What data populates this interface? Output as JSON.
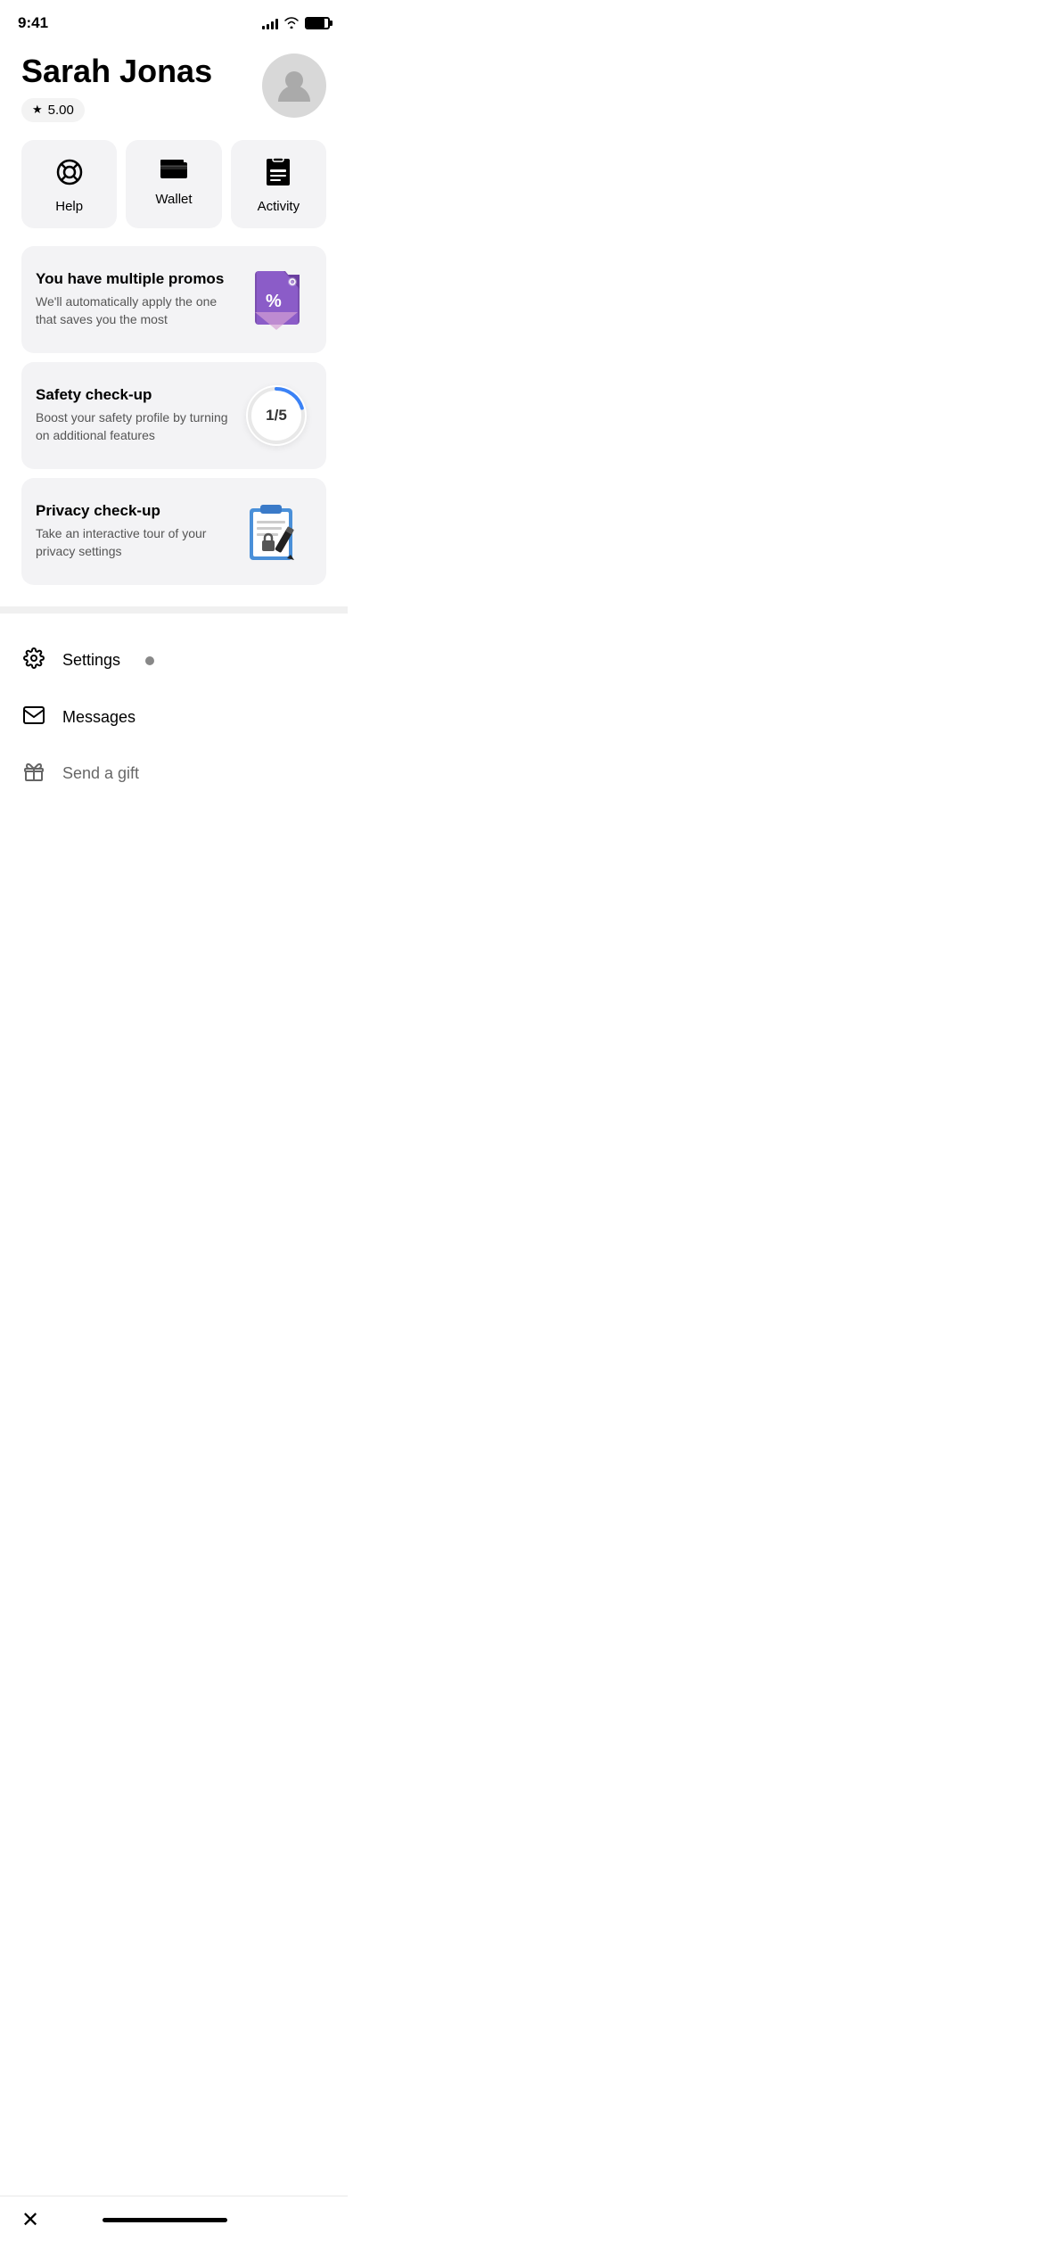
{
  "statusBar": {
    "time": "9:41",
    "signalBars": [
      4,
      6,
      8,
      10,
      12
    ],
    "batteryLevel": 85
  },
  "header": {
    "userName": "Sarah Jonas",
    "rating": "5.00",
    "ratingAriaLabel": "Rating: 5.00 stars",
    "avatarAlt": "User avatar"
  },
  "quickActions": [
    {
      "id": "help",
      "label": "Help",
      "icon": "help-icon"
    },
    {
      "id": "wallet",
      "label": "Wallet",
      "icon": "wallet-icon"
    },
    {
      "id": "activity",
      "label": "Activity",
      "icon": "activity-icon"
    }
  ],
  "promoCards": [
    {
      "id": "promos",
      "title": "You have multiple promos",
      "description": "We'll automatically apply the one that saves you the most",
      "visualType": "promo-tag"
    },
    {
      "id": "safety",
      "title": "Safety check-up",
      "description": "Boost your safety profile by turning on additional features",
      "visualType": "safety-progress",
      "progressText": "1/5"
    },
    {
      "id": "privacy",
      "title": "Privacy check-up",
      "description": "Take an interactive tour of your privacy settings",
      "visualType": "privacy-clipboard"
    }
  ],
  "menuItems": [
    {
      "id": "settings",
      "label": "Settings",
      "icon": "gear-icon",
      "hasBadge": true
    },
    {
      "id": "messages",
      "label": "Messages",
      "icon": "mail-icon",
      "hasBadge": false
    },
    {
      "id": "send-gift",
      "label": "Send a gift",
      "icon": "gift-icon",
      "hasBadge": false,
      "partiallyVisible": true
    }
  ],
  "bottomNav": {
    "closeLabel": "✕"
  }
}
